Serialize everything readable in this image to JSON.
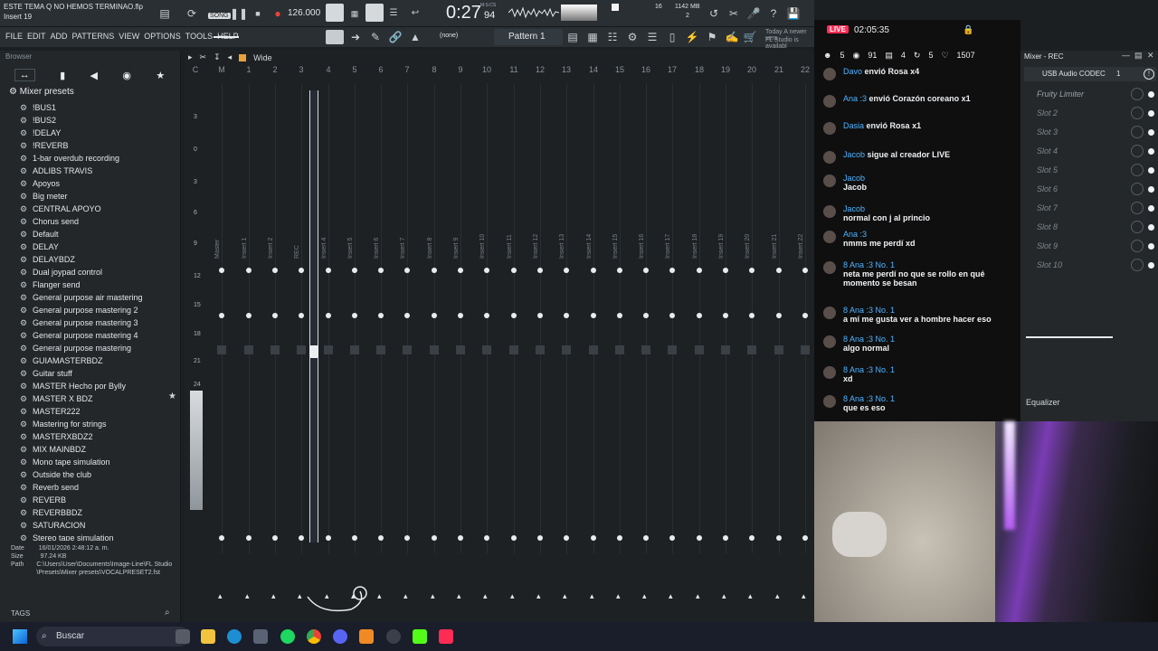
{
  "window": {
    "title": "ESTE TEMA Q NO HEMOS TERMINAO.flp",
    "subtitle": "Insert 19"
  },
  "transport": {
    "song_label": "SONG",
    "bpm": "126.000",
    "time": "0:27",
    "time_sub": "94",
    "time_unit": "M:S:CS",
    "cpu_num": "16",
    "mem": "1142 MB",
    "mem_sub": "2"
  },
  "menu": [
    "FILE",
    "EDIT",
    "ADD",
    "PATTERNS",
    "VIEW",
    "OPTIONS",
    "TOOLS",
    "HELP"
  ],
  "toolbar": {
    "pattern_label": "Pattern 1",
    "none_label": "(none)",
    "news": "Today  A newer vers",
    "news2": "FL Studio is availabl"
  },
  "browser": {
    "title": "Browser",
    "folder": "Mixer presets",
    "items": [
      "!BUS1",
      "!BUS2",
      "!DELAY",
      "!REVERB",
      "1-bar overdub recording",
      "ADLIBS TRAVIS",
      "Apoyos",
      "Big meter",
      "CENTRAL APOYO",
      "Chorus send",
      "Default",
      "DELAY",
      "DELAYBDZ",
      "Dual joypad control",
      "Flanger send",
      "General purpose air mastering",
      "General purpose mastering 2",
      "General purpose mastering 3",
      "General purpose mastering 4",
      "General purpose mastering",
      "GUIAMASTERBDZ",
      "Guitar stuff",
      "MASTER Hecho por Bylly",
      "MASTER X BDZ",
      "MASTER222",
      "Mastering for strings",
      "MASTERXBDZ2",
      "MIX MAINBDZ",
      "Mono tape simulation",
      "Outside the club",
      "Reverb send",
      "REVERB",
      "REVERBBDZ",
      "SATURACION",
      "Stereo tape simulation"
    ],
    "info": {
      "date_label": "Date",
      "date": "16/01/2026 2:48:12 a. m.",
      "size_label": "Size",
      "size": "97.24 KB",
      "path_label": "Path",
      "path": "C:\\Users\\User\\Documents\\Image-Line\\FL Studio\\Presets\\Mixer presets\\VOCALPRESET2.fst"
    },
    "tags": "TAGS"
  },
  "mixer": {
    "view": "Wide",
    "columns": [
      "C",
      "M",
      "1",
      "2",
      "3",
      "4",
      "5",
      "6",
      "7",
      "8",
      "9",
      "10",
      "11",
      "12",
      "13",
      "14",
      "15",
      "16",
      "17",
      "18",
      "19",
      "20",
      "21",
      "22"
    ],
    "labels": [
      "Master",
      "Insert 1",
      "Insert 2",
      "REC",
      "Insert 4",
      "Insert 5",
      "Insert 6",
      "Insert 7",
      "Insert 8",
      "Insert 9",
      "Insert 10",
      "Insert 11",
      "Insert 12",
      "Insert 13",
      "Insert 14",
      "Insert 15",
      "Insert 16",
      "Insert 17",
      "Insert 18",
      "Insert 19",
      "Insert 20",
      "Insert 21",
      "Insert 22"
    ],
    "scale": [
      "3",
      "0",
      "3",
      "6",
      "9",
      "12",
      "15",
      "18",
      "21",
      "24"
    ]
  },
  "live": {
    "badge": "LIVE",
    "timer": "02:05:35",
    "viewers": "5",
    "watch": "91",
    "gifts": "4",
    "shares": "5",
    "likes": "1507"
  },
  "chat": [
    {
      "who": "Davo",
      "text": "envió Rosa",
      "extra": "x4"
    },
    {
      "who": "Ana :3",
      "text": "envió Corazón coreano",
      "extra": "x1"
    },
    {
      "who": "Dasia",
      "text": "envió Rosa",
      "extra": "x1"
    },
    {
      "who": "Jacob",
      "text": "sigue al creador LIVE",
      "extra": ""
    },
    {
      "who": "Jacob",
      "text": "Jacob",
      "extra": ""
    },
    {
      "who": "Jacob",
      "text": "normal con j al princio",
      "extra": ""
    },
    {
      "who": "Ana :3",
      "text": "nmms me perdí xd",
      "extra": ""
    },
    {
      "who": "8 Ana :3  No. 1",
      "text": "neta me perdí no que se rollo en qué momento se besan",
      "extra": ""
    },
    {
      "who": "8 Ana :3  No. 1",
      "text": "a mí me gusta ver a hombre hacer eso",
      "extra": ""
    },
    {
      "who": "8 Ana :3  No. 1",
      "text": "algo normal",
      "extra": ""
    },
    {
      "who": "8 Ana :3  No. 1",
      "text": "xd",
      "extra": ""
    },
    {
      "who": "8 Ana :3  No. 1",
      "text": "que es eso",
      "extra": ""
    }
  ],
  "rpanel": {
    "title": "Mixer - REC",
    "device": "USB Audio CODEC",
    "device_num": "1",
    "slots": [
      "Fruity Limiter",
      "Slot 2",
      "Slot 3",
      "Slot 4",
      "Slot 5",
      "Slot 6",
      "Slot 7",
      "Slot 8",
      "Slot 9",
      "Slot 10"
    ],
    "eq": "Equalizer"
  },
  "taskbar": {
    "search": "Buscar"
  }
}
